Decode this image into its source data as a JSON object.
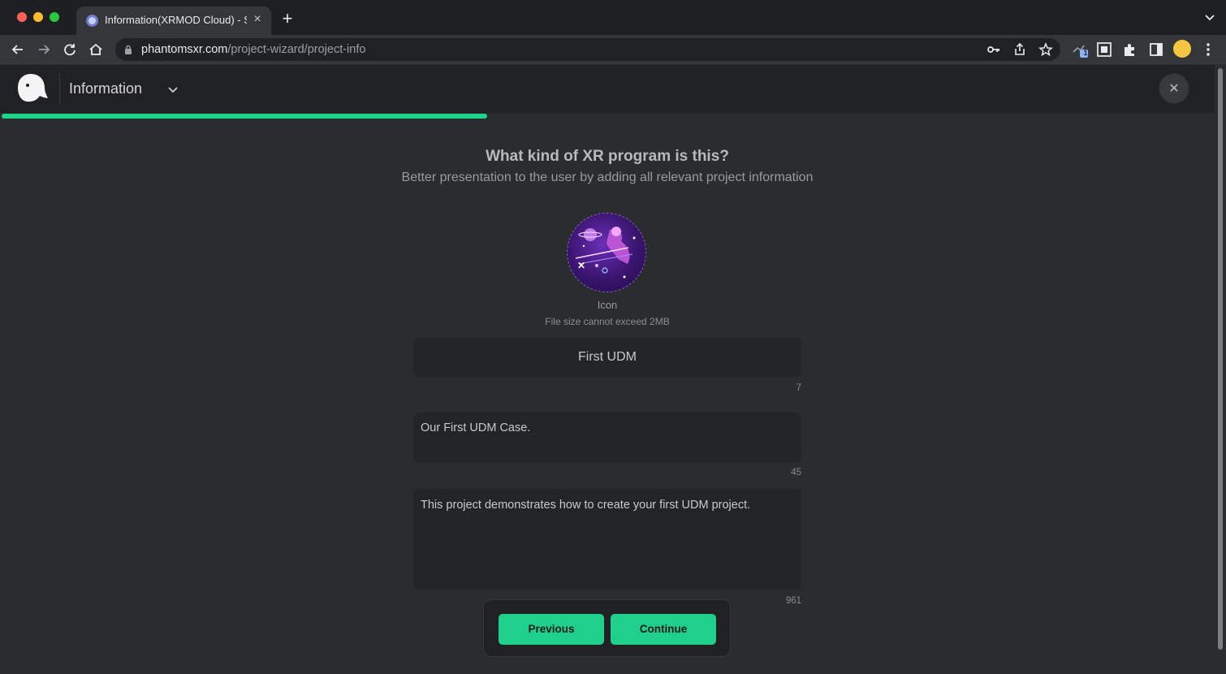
{
  "browser": {
    "tab_title": "Information(XRMOD Cloud) - S",
    "url_host": "phantomsxr.com",
    "url_path": "/project-wizard/project-info",
    "extension_badge": "1"
  },
  "header": {
    "title": "Information"
  },
  "progress": {
    "percent": 40
  },
  "main": {
    "heading": "What kind of XR program is this?",
    "subheading": "Better presentation to the user by adding all relevant project information",
    "icon_label": "Icon",
    "icon_hint": "File size cannot exceed 2MB",
    "name_value": "First UDM",
    "name_counter": "7",
    "summary_value": "Our First UDM Case.",
    "summary_counter": "45",
    "description_value": "This project demonstrates how to create your first UDM project.",
    "description_counter": "961"
  },
  "actions": {
    "previous_label": "Previous",
    "continue_label": "Continue"
  },
  "colors": {
    "accent": "#1ed48a",
    "background": "#2b2c2f"
  }
}
